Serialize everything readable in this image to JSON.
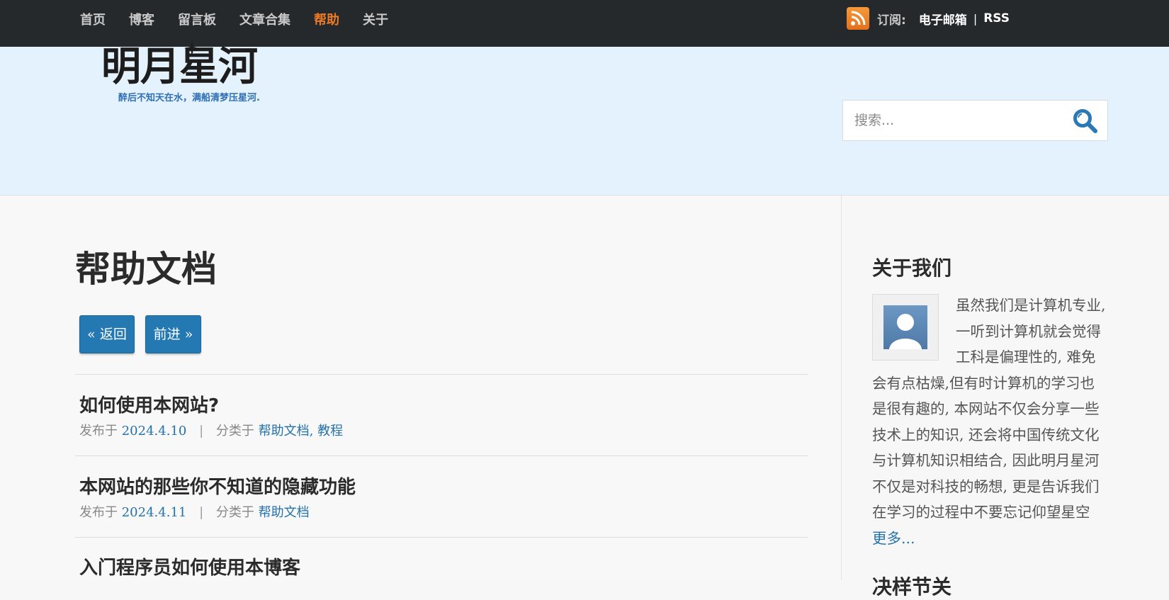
{
  "nav": {
    "items": [
      {
        "label": "首页"
      },
      {
        "label": "博客"
      },
      {
        "label": "留言板"
      },
      {
        "label": "文章合集"
      },
      {
        "label": "帮助"
      },
      {
        "label": "关于"
      }
    ],
    "active_index": 4
  },
  "subscribe": {
    "label": "订阅:",
    "email_link": "电子邮箱",
    "separator": "|",
    "rss_link": "RSS"
  },
  "logo": {
    "title": "明月星河",
    "tagline": "醉后不知天在水，满船清梦压星河."
  },
  "search": {
    "placeholder": "搜索..."
  },
  "main": {
    "page_title": "帮助文档",
    "back_button": "« 返回",
    "forward_button": "前进 »",
    "posts": [
      {
        "title": "如何使用本网站?",
        "published_prefix": "发布于",
        "date": "2024.4.10",
        "meta_sep": "|",
        "category_prefix": "分类于",
        "categories": "帮助文档",
        "categories_extra_sep": ",",
        "categories_extra": "教程"
      },
      {
        "title": "本网站的那些你不知道的隐藏功能",
        "published_prefix": "发布于",
        "date": "2024.4.11",
        "meta_sep": "|",
        "category_prefix": "分类于",
        "categories": "帮助文档"
      },
      {
        "title": "入门程序员如何使用本博客"
      }
    ]
  },
  "sidebar": {
    "about_title": "关于我们",
    "about_text": "虽然我们是计算机专业, 一听到计算机就会觉得工科是偏理性的, 难免会有点枯燥,但有时计算机的学习也是很有趣的, 本网站不仅会分享一些技术上的知识, 还会将中国传统文化与计算机知识相结合, 因此明月星河不仅是对科技的畅想, 更是告诉我们在学习的过程中不要忘记仰望星空",
    "more_link": "更多...",
    "next_title": "决样节关"
  },
  "colors": {
    "topbar": "#25292c",
    "accent_orange": "#ee7b22",
    "link_blue": "#2472ab",
    "button_blue": "#2579b2",
    "header_bg": "#e3f2fc"
  },
  "icons": {
    "rss": "rss-icon",
    "search": "search-icon",
    "avatar": "user-avatar-icon",
    "star": "star-icon"
  }
}
